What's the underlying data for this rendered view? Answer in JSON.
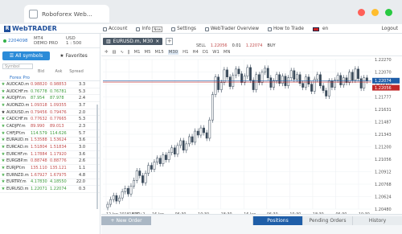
{
  "browser": {
    "tab_title": "Roboforex Web...",
    "dot_colors": [
      "#ff6058",
      "#ffbd2e",
      "#28c941"
    ]
  },
  "header": {
    "logo": "WebTRADER",
    "logo_mark": "R",
    "menu": [
      {
        "label": "Account",
        "icon": "user-icon"
      },
      {
        "label": "Info",
        "icon": "info-icon",
        "badge": "New"
      },
      {
        "label": "Settings",
        "icon": "gear-icon"
      },
      {
        "label": "WebTrader Overview",
        "icon": "book-icon"
      },
      {
        "label": "How to Trade",
        "icon": "question-icon"
      },
      {
        "label": "en",
        "icon": "flag-icon"
      }
    ],
    "logout": "Logout"
  },
  "account": {
    "number": "2204098",
    "platform": "MT4",
    "type": "DEMO PRO",
    "currency": "USD",
    "leverage": "1 : 500"
  },
  "symbols": {
    "tabs": [
      "All symbols",
      "Favorites"
    ],
    "search_placeholder": "Symbol",
    "columns": [
      "Bid",
      "Ask",
      "Spread"
    ],
    "category": "Forex Pro",
    "rows": [
      {
        "name": "AUDCAD.m",
        "bid": "0.98820",
        "ask": "0.98853",
        "spread": "3.3",
        "up": false,
        "fav": false
      },
      {
        "name": "AUDCHF.m",
        "bid": "0.76778",
        "ask": "0.76781",
        "spread": "5.3",
        "up": true,
        "fav": false
      },
      {
        "name": "AUDJPY.m",
        "bid": "87.954",
        "ask": "87.978",
        "spread": "2.4",
        "up": true,
        "fav": false
      },
      {
        "name": "AUDNZD.m",
        "bid": "1.09318",
        "ask": "1.09355",
        "spread": "3.7",
        "up": false,
        "fav": false
      },
      {
        "name": "AUDUSD.m",
        "bid": "0.79456",
        "ask": "0.79476",
        "spread": "2.0",
        "up": false,
        "fav": true
      },
      {
        "name": "CADCHF.m",
        "bid": "0.77632",
        "ask": "0.77665",
        "spread": "5.3",
        "up": false,
        "fav": false
      },
      {
        "name": "CADJPY.m",
        "bid": "89.990",
        "ask": "89.013",
        "spread": "2.3",
        "up": false,
        "fav": false
      },
      {
        "name": "CHFJPY.m",
        "bid": "114.579",
        "ask": "114.626",
        "spread": "5.7",
        "up": true,
        "fav": false
      },
      {
        "name": "EURAUD.m",
        "bid": "1.53588",
        "ask": "1.53624",
        "spread": "3.6",
        "up": false,
        "fav": false
      },
      {
        "name": "EURCAD.m",
        "bid": "1.51804",
        "ask": "1.51834",
        "spread": "3.0",
        "up": false,
        "fav": false
      },
      {
        "name": "EURCHF.m",
        "bid": "1.17884",
        "ask": "1.17920",
        "spread": "3.6",
        "up": false,
        "fav": false
      },
      {
        "name": "EURGBP.m",
        "bid": "0.88748",
        "ask": "0.88776",
        "spread": "2.6",
        "up": false,
        "fav": false
      },
      {
        "name": "EURJPY.m",
        "bid": "135.110",
        "ask": "135.121",
        "spread": "1.1",
        "up": false,
        "fav": false
      },
      {
        "name": "EURNZD.m",
        "bid": "1.67927",
        "ask": "1.67975",
        "spread": "4.8",
        "up": false,
        "fav": false
      },
      {
        "name": "EURTRY.m",
        "bid": "4.17830",
        "ask": "4.18550",
        "spread": "22.0",
        "up": true,
        "fav": false
      },
      {
        "name": "EURUSD.m",
        "bid": "1.22071",
        "ask": "1.22074",
        "spread": "0.3",
        "up": true,
        "fav": false
      }
    ]
  },
  "chart_tab": {
    "label": "EURUSD.m, M30",
    "plus": "+"
  },
  "toolbar": {
    "timeframes": [
      "M1",
      "M5",
      "M15",
      "M30",
      "H1",
      "H4",
      "D1",
      "W1",
      "MN"
    ],
    "selected": "M30"
  },
  "trade": {
    "sell_label": "SELL",
    "sell_price": "1.22056",
    "lot": "0.01",
    "buy_price": "1.22074",
    "buy_label": "BUY"
  },
  "bottom": {
    "new_order": "New Order",
    "tabs": [
      "Positions",
      "Pending Orders",
      "History"
    ],
    "active_tab": "Positions"
  },
  "chart_data": {
    "type": "candlestick",
    "y_ticks": [
      "1.22270",
      "1.22070",
      "1.21910",
      "1.21777",
      "1.21631",
      "1.21487",
      "1.21343",
      "1.21200",
      "1.21056",
      "1.20912",
      "1.20768",
      "1.20624",
      "1.20480"
    ],
    "ylim": [
      1.2046,
      1.2234
    ],
    "x_ticks": [
      "12 Jan 2018, UTC+2",
      "18:30",
      "16 Jan",
      "06:30",
      "10:30",
      "18:30",
      "16 Jan",
      "06:30",
      "10:30",
      "18:30",
      "06:30",
      "10:30"
    ],
    "bid_label": "1.22074",
    "ask_label": "1.22056",
    "bid_value": 1.22074,
    "ask_value": 1.22056,
    "bid_color": "#1f5ea8",
    "ask_color": "#c22828",
    "bull_color": "#ffffff",
    "bear_color": "#3a4a5a",
    "closes": [
      1.2052,
      1.2058,
      1.2063,
      1.2056,
      1.206,
      1.2068,
      1.2072,
      1.2065,
      1.2075,
      1.2082,
      1.2094,
      1.2088,
      1.2079,
      1.2091,
      1.2101,
      1.2096,
      1.2105,
      1.211,
      1.2103,
      1.2114,
      1.2108,
      1.2117,
      1.2123,
      1.2115,
      1.2126,
      1.2132,
      1.212,
      1.2128,
      1.2137,
      1.213,
      1.2144,
      1.2139,
      1.2148,
      1.2142,
      1.2135,
      1.2158,
      1.219,
      1.2212,
      1.2196,
      1.2205,
      1.2221,
      1.2212,
      1.22,
      1.2214,
      1.2222,
      1.2216,
      1.2205,
      1.2213,
      1.2224,
      1.2208,
      1.2196,
      1.2215,
      1.2205,
      1.2218,
      1.2223,
      1.2211,
      1.2199,
      1.2207,
      1.2215,
      1.2204,
      1.2213,
      1.2201,
      1.2211,
      1.222,
      1.2209,
      1.2215,
      1.2204,
      1.2199,
      1.2212,
      1.2203,
      1.2194,
      1.2209,
      1.2215,
      1.2201,
      1.2195,
      1.2188,
      1.2207,
      1.2199,
      1.2208,
      1.2214,
      1.2202,
      1.2211,
      1.2205,
      1.2218,
      1.2208,
      1.2222,
      1.221,
      1.2198,
      1.2211,
      1.2207
    ]
  }
}
